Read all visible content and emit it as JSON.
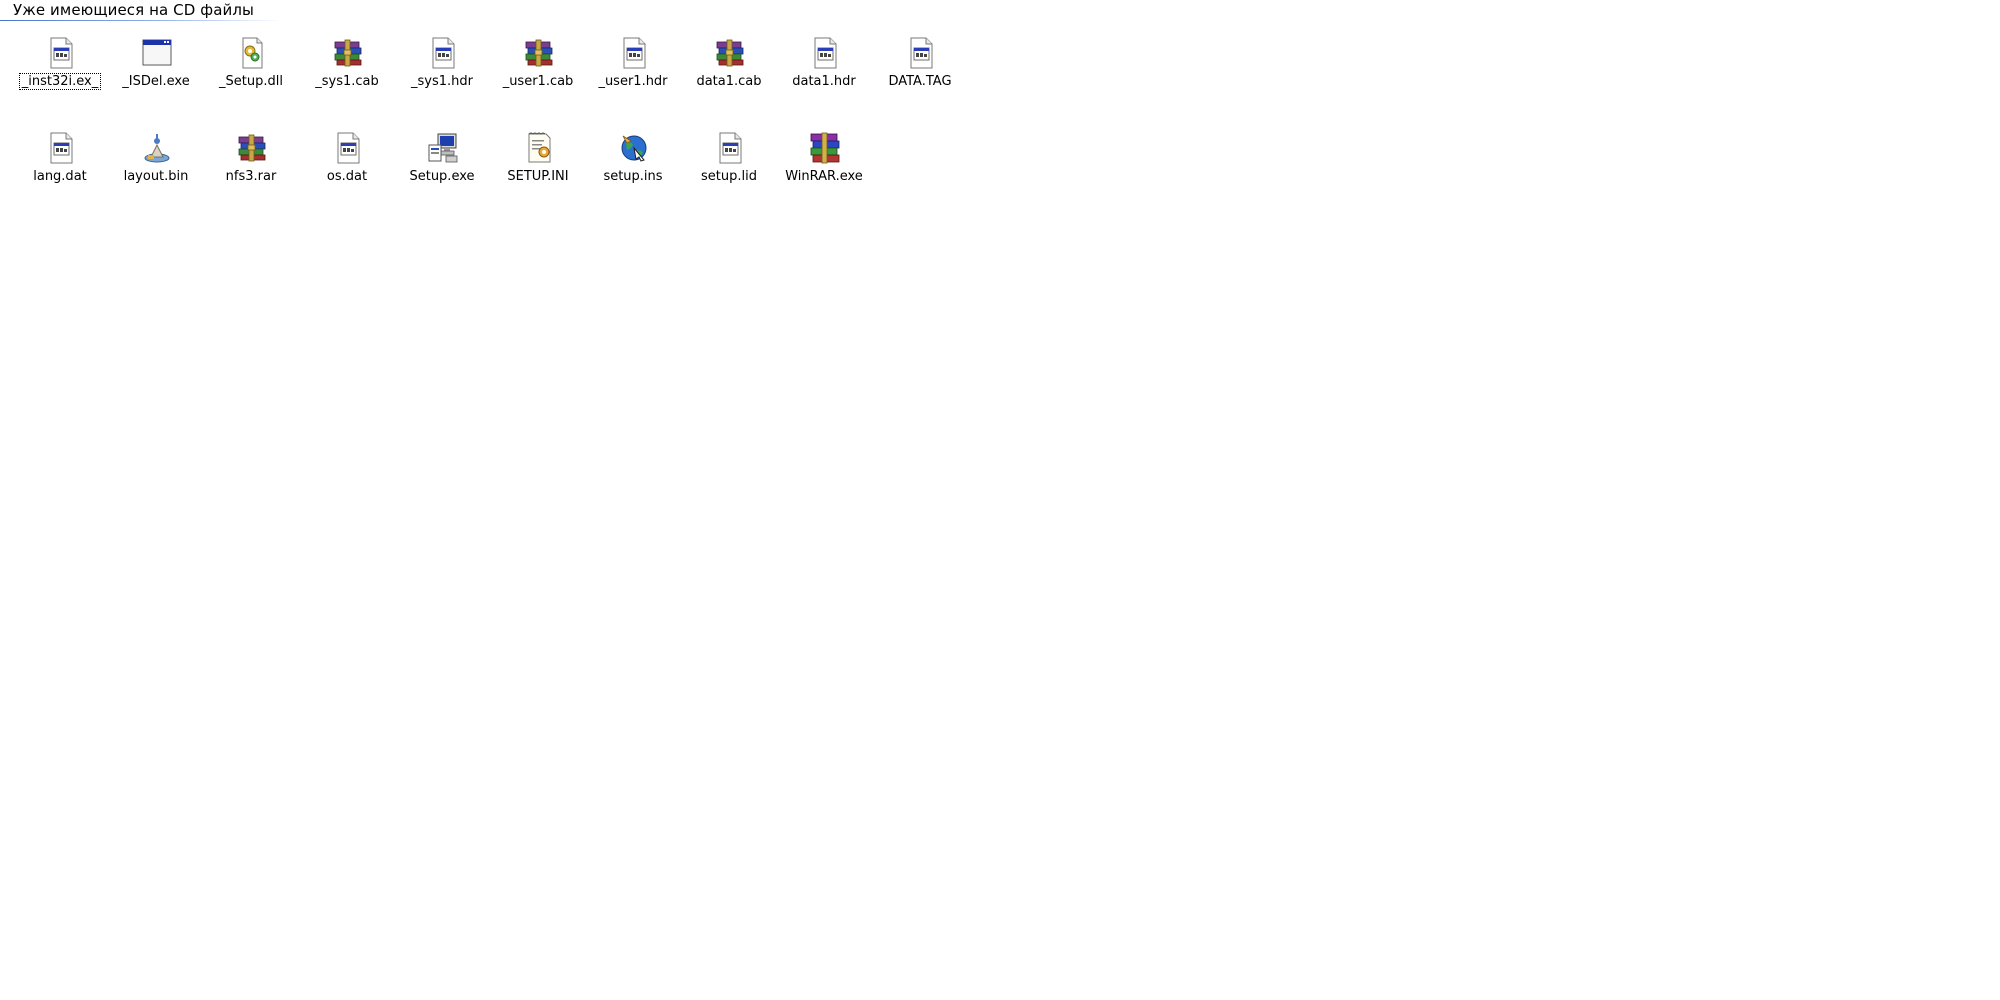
{
  "group": {
    "title": "Уже имеющиеся на CD файлы"
  },
  "rows": [
    [
      {
        "name": "_inst32i.ex_",
        "icon": "generic-file-icon",
        "focused": true
      },
      {
        "name": "_ISDel.exe",
        "icon": "application-window-icon"
      },
      {
        "name": "_Setup.dll",
        "icon": "dll-gear-icon"
      },
      {
        "name": "_sys1.cab",
        "icon": "winrar-archive-icon"
      },
      {
        "name": "_sys1.hdr",
        "icon": "generic-file-icon"
      },
      {
        "name": "_user1.cab",
        "icon": "winrar-archive-icon"
      },
      {
        "name": "_user1.hdr",
        "icon": "generic-file-icon"
      },
      {
        "name": "data1.cab",
        "icon": "winrar-archive-icon"
      },
      {
        "name": "data1.hdr",
        "icon": "generic-file-icon"
      },
      {
        "name": "DATA.TAG",
        "icon": "generic-file-icon"
      }
    ],
    [
      {
        "name": "lang.dat",
        "icon": "generic-file-icon"
      },
      {
        "name": "layout.bin",
        "icon": "installer-bin-icon"
      },
      {
        "name": "nfs3.rar",
        "icon": "winrar-archive-icon"
      },
      {
        "name": "os.dat",
        "icon": "generic-file-icon"
      },
      {
        "name": "Setup.exe",
        "icon": "setup-computer-icon"
      },
      {
        "name": "SETUP.INI",
        "icon": "ini-settings-icon"
      },
      {
        "name": "setup.ins",
        "icon": "globe-script-icon"
      },
      {
        "name": "setup.lid",
        "icon": "generic-file-icon"
      },
      {
        "name": "WinRAR.exe",
        "icon": "winrar-app-icon"
      }
    ]
  ]
}
